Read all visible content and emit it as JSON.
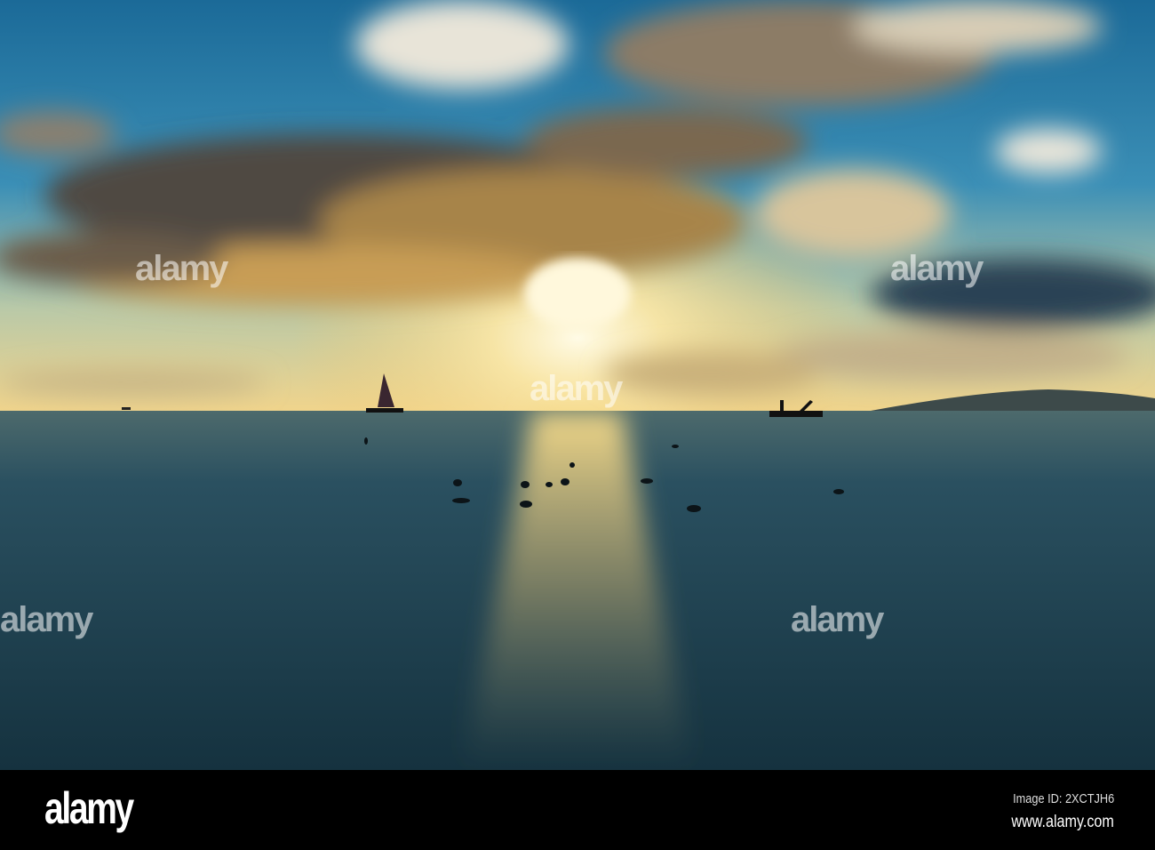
{
  "photo": {
    "subject": "sunset-over-ocean",
    "watermark": "alamy",
    "colors": {
      "sky_top": "#1f6f9c",
      "sky_gold": "#f1d68a",
      "sea": "#1d3e4c",
      "sun": "#fff6d2"
    }
  },
  "footer": {
    "logo": "alamy",
    "image_id": "Image ID: 2XCTJH6",
    "url": "www.alamy.com"
  }
}
